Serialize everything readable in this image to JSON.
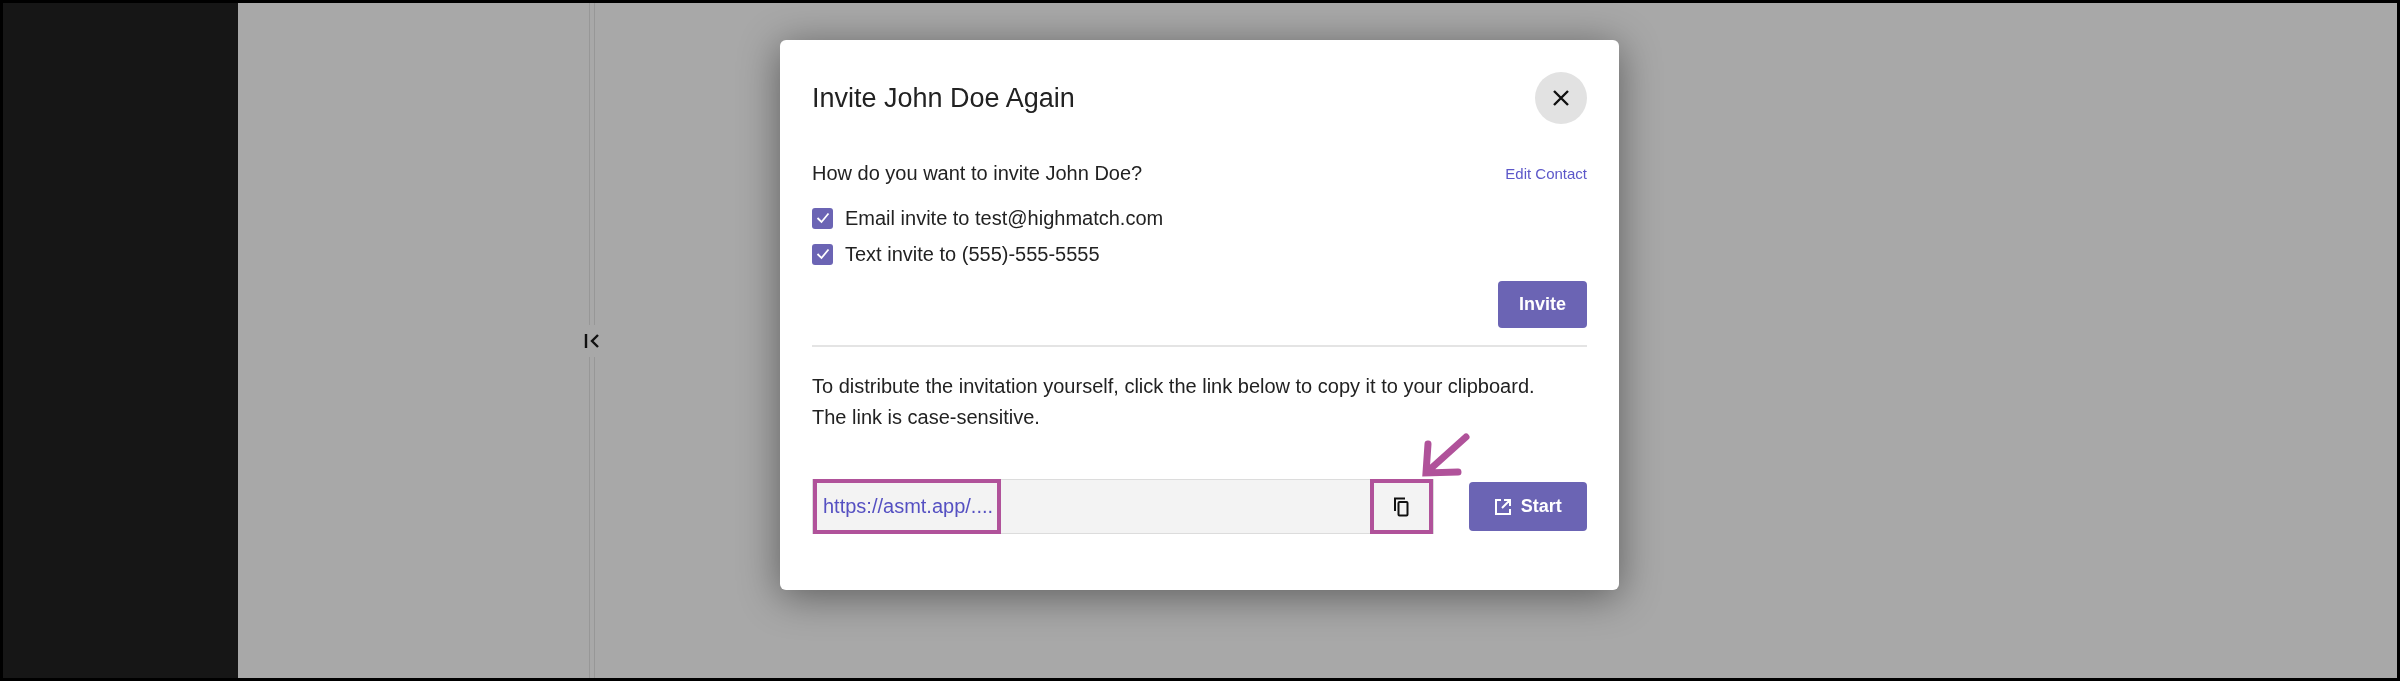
{
  "dialog": {
    "title": "Invite John Doe Again",
    "question": "How do you want to invite John Doe?",
    "edit_contact": "Edit Contact",
    "options": [
      {
        "label": "Email invite to test@highmatch.com",
        "checked": true
      },
      {
        "label": "Text invite to (555)-555-5555",
        "checked": true
      }
    ],
    "invite_button": "Invite",
    "instructions": "To distribute the invitation yourself, click the link below to copy it to your clipboard. The link is case-sensitive.",
    "link": "https://asmt.app/....",
    "start_button": "Start"
  }
}
